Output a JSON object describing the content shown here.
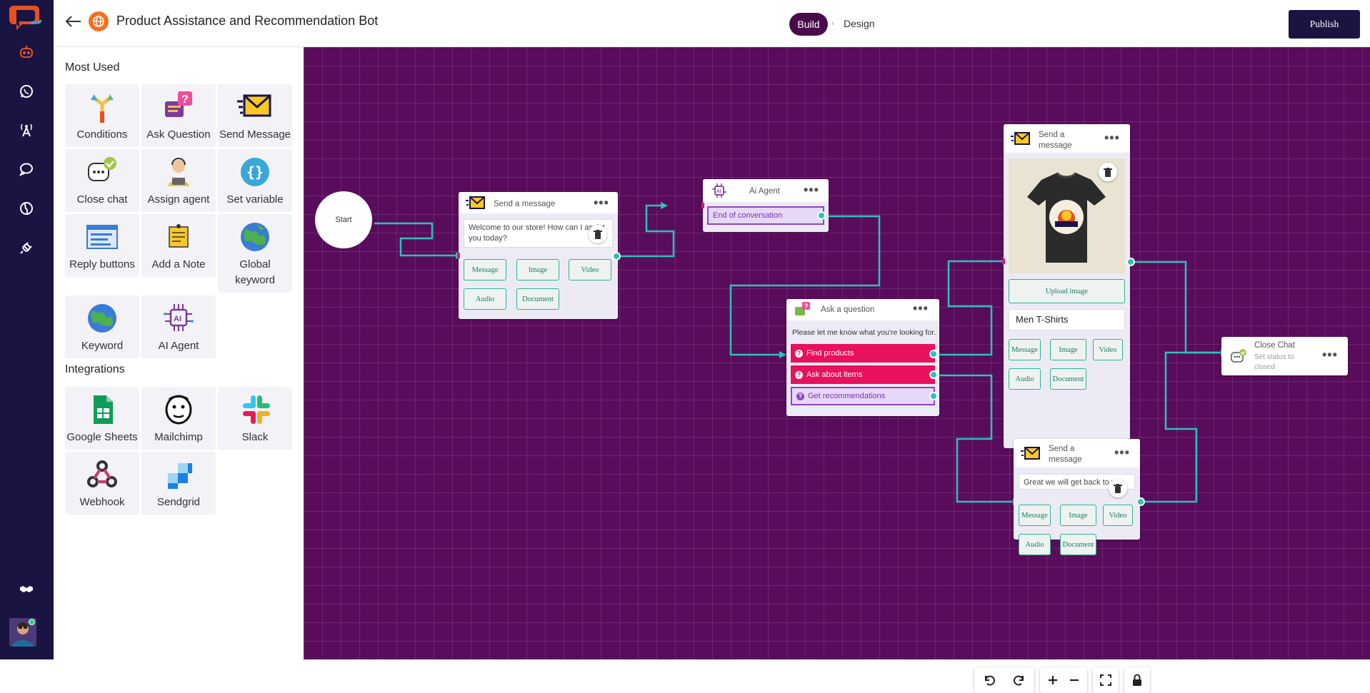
{
  "header": {
    "title": "Product Assistance and Recommendation Bot",
    "tabs": [
      "Build",
      "Design"
    ],
    "publish_label": "Publish"
  },
  "panel": {
    "most_used_title": "Most Used",
    "integrations_title": "Integrations",
    "most_used": [
      {
        "label": "Conditions",
        "icon": "conditions-icon"
      },
      {
        "label": "Ask Question",
        "icon": "ask-question-icon"
      },
      {
        "label": "Send Message",
        "icon": "send-message-icon"
      },
      {
        "label": "Close chat",
        "icon": "close-chat-icon"
      },
      {
        "label": "Assign agent",
        "icon": "assign-agent-icon"
      },
      {
        "label": "Set variable",
        "icon": "set-variable-icon"
      },
      {
        "label": "Reply buttons",
        "icon": "reply-buttons-icon"
      },
      {
        "label": "Add a Note",
        "icon": "add-note-icon"
      },
      {
        "label": "Global keyword",
        "icon": "globe-icon"
      },
      {
        "label": "Keyword",
        "icon": "keyword-globe-icon"
      },
      {
        "label": "AI Agent",
        "icon": "ai-chip-icon"
      }
    ],
    "integrations": [
      {
        "label": "Google Sheets",
        "icon": "google-sheets-icon"
      },
      {
        "label": "Mailchimp",
        "icon": "mailchimp-icon"
      },
      {
        "label": "Slack",
        "icon": "slack-icon"
      },
      {
        "label": "Webhook",
        "icon": "webhook-icon"
      },
      {
        "label": "Sendgrid",
        "icon": "sendgrid-icon"
      }
    ]
  },
  "flow": {
    "start": {
      "label": "Start"
    },
    "msg1": {
      "title": "Send a message",
      "text": "Welcome to our store! How can I assist you today?",
      "buttons": [
        "Message",
        "Image",
        "Video",
        "Audio",
        "Document"
      ]
    },
    "ai": {
      "title": "Ai Agent",
      "option": "End of conversation"
    },
    "ask": {
      "title": "Ask a question",
      "prompt": "Please let me know what you're looking for.",
      "options": [
        "Find products",
        "Ask about items",
        "Get recommendations"
      ]
    },
    "msg2": {
      "title_line1": "Send a",
      "title_line2": "message",
      "upload_label": "Upload image",
      "caption": "Men T-Shirts",
      "buttons": [
        "Message",
        "Image",
        "Video",
        "Audio",
        "Document"
      ]
    },
    "msg3": {
      "title_line1": "Send a",
      "title_line2": "message",
      "text": "Great we will get back to you",
      "buttons": [
        "Message",
        "Image",
        "Video",
        "Audio",
        "Document"
      ]
    },
    "close": {
      "title": "Close Chat",
      "sub_line1": "Set status to",
      "sub_line2": "closed"
    }
  },
  "colors": {
    "rail": "#1a1443",
    "canvas": "#5a0c5c",
    "accent": "#2ac3b6",
    "option_pink": "#e8115e",
    "build_tab": "#4a0b4a",
    "publish": "#1a1443"
  }
}
